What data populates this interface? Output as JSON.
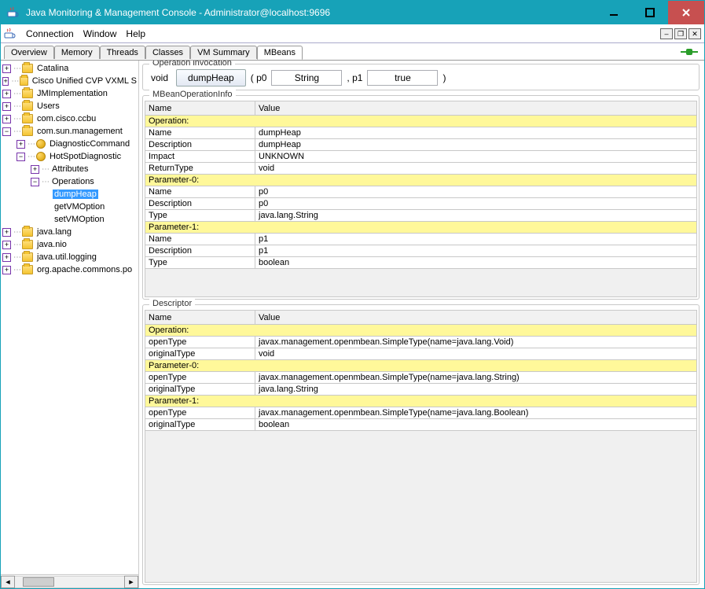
{
  "window": {
    "title": "Java Monitoring & Management Console - Administrator@localhost:9696"
  },
  "menu": {
    "connection": "Connection",
    "window": "Window",
    "help": "Help"
  },
  "tabs": {
    "overview": "Overview",
    "memory": "Memory",
    "threads": "Threads",
    "classes": "Classes",
    "vmsummary": "VM Summary",
    "mbeans": "MBeans"
  },
  "tree": {
    "catalina": "Catalina",
    "ciscoCvp": "Cisco Unified CVP VXML S",
    "jmimpl": "JMImplementation",
    "users": "Users",
    "ccbu": "com.cisco.ccbu",
    "sunmgmt": "com.sun.management",
    "diagCmd": "DiagnosticCommand",
    "hotspot": "HotSpotDiagnostic",
    "attributes": "Attributes",
    "operations": "Operations",
    "dumpHeap": "dumpHeap",
    "getVMOption": "getVMOption",
    "setVMOption": "setVMOption",
    "javalang": "java.lang",
    "javanio": "java.nio",
    "javautil": "java.util.logging",
    "apache": "org.apache.commons.po"
  },
  "invoke": {
    "legend": "Operation invocation",
    "returnType": "void",
    "button": "dumpHeap",
    "p0label": "( p0",
    "p0value": "String",
    "p1label": ", p1",
    "p1value": "true",
    "close": ")"
  },
  "opinfo": {
    "legend": "MBeanOperationInfo",
    "hName": "Name",
    "hValue": "Value",
    "rows": {
      "opHdr": "Operation:",
      "name_n": "Name",
      "name_v": "dumpHeap",
      "desc_n": "Description",
      "desc_v": "dumpHeap",
      "impact_n": "Impact",
      "impact_v": "UNKNOWN",
      "ret_n": "ReturnType",
      "ret_v": "void",
      "p0Hdr": "Parameter-0:",
      "p0name_n": "Name",
      "p0name_v": "p0",
      "p0desc_n": "Description",
      "p0desc_v": "p0",
      "p0type_n": "Type",
      "p0type_v": "java.lang.String",
      "p1Hdr": "Parameter-1:",
      "p1name_n": "Name",
      "p1name_v": "p1",
      "p1desc_n": "Description",
      "p1desc_v": "p1",
      "p1type_n": "Type",
      "p1type_v": "boolean"
    }
  },
  "descriptor": {
    "legend": "Descriptor",
    "hName": "Name",
    "hValue": "Value",
    "rows": {
      "opHdr": "Operation:",
      "open_n": "openType",
      "open_v": "javax.management.openmbean.SimpleType(name=java.lang.Void)",
      "orig_n": "originalType",
      "orig_v": "void",
      "p0Hdr": "Parameter-0:",
      "p0open_n": "openType",
      "p0open_v": "javax.management.openmbean.SimpleType(name=java.lang.String)",
      "p0orig_n": "originalType",
      "p0orig_v": "java.lang.String",
      "p1Hdr": "Parameter-1:",
      "p1open_n": "openType",
      "p1open_v": "javax.management.openmbean.SimpleType(name=java.lang.Boolean)",
      "p1orig_n": "originalType",
      "p1orig_v": "boolean"
    }
  }
}
